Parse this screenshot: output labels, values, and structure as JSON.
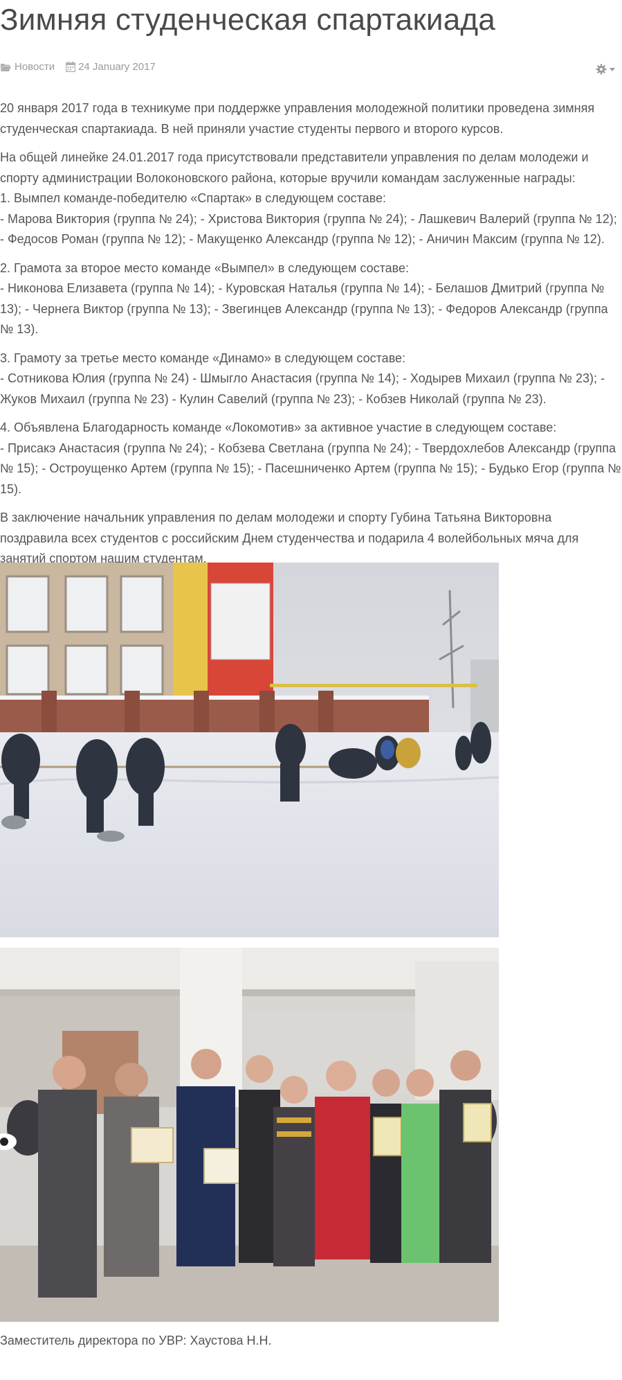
{
  "article": {
    "title": "Зимняя студенческая спартакиада",
    "meta": {
      "category": "Новости",
      "category_icon": "folder-open-icon",
      "date": "24 January 2017",
      "date_icon": "calendar-icon",
      "tools_icon": "gear-icon"
    },
    "paragraphs": {
      "p1": "20 января 2017 года в техникуме при поддержке управления молодежной политики проведена зимняя студенческая спартакиада. В ней приняли участие студенты первого и второго курсов.",
      "p2_line1": "На общей линейке 24.01.2017 года присутствовали представители управления по делам молодежи и спорту администрации Волоконовского района, которые вручили командам заслуженные награды:",
      "p2_line2": "1. Вымпел команде-победителю «Спартак» в следующем составе:",
      "p2_line3": "- Марова Виктория (группа № 24); - Христова Виктория (группа № 24); - Лашкевич Валерий (группа № 12); - Федосов Роман (группа № 12); - Макущенко Александр (группа № 12); - Аничин Максим (группа № 12).",
      "p3_line1": "2. Грамота за второе место команде «Вымпел» в следующем составе:",
      "p3_line2": "- Никонова Елизавета (группа № 14); - Куровская Наталья (группа № 14); - Белашов Дмитрий (группа № 13); - Чернега Виктор (группа № 13); - Звегинцев Александр (группа № 13); - Федоров Александр (группа № 13).",
      "p4_line1": "3. Грамоту за третье место команде «Динамо» в следующем составе:",
      "p4_line2": "- Сотникова Юлия (группа № 24) - Шмыгло Анастасия (группа № 14); - Ходырев Михаил (группа № 23); - Жуков Михаил (группа № 23) - Кулин Савелий (группа № 23); - Кобзев Николай (группа № 23).",
      "p5_line1": "4. Объявлена Благодарность команде «Локомотив» за активное участие в следующем составе:",
      "p5_line2": "- Присакэ Анастасия (группа № 24); - Кобзева Светлана (группа № 24); - Твердохлебов Александр (группа № 15); - Остроущенко Артем (группа № 15); - Пасешниченко Артем (группа № 15); - Будько Егор (группа № 15).",
      "p6": "В заключение начальник управления по делам молодежи и спорту Губина Татьяна Викторовна поздравила всех студентов с российским Днем студенчества и подарила 4 волейбольных мяча для занятий спортом нашим студентам."
    },
    "caption": "Заместитель директора по УВР: Хаустова Н.Н."
  },
  "colors": {
    "text": "#555555",
    "title": "#4a4a4a",
    "meta": "#9a9a9a"
  }
}
